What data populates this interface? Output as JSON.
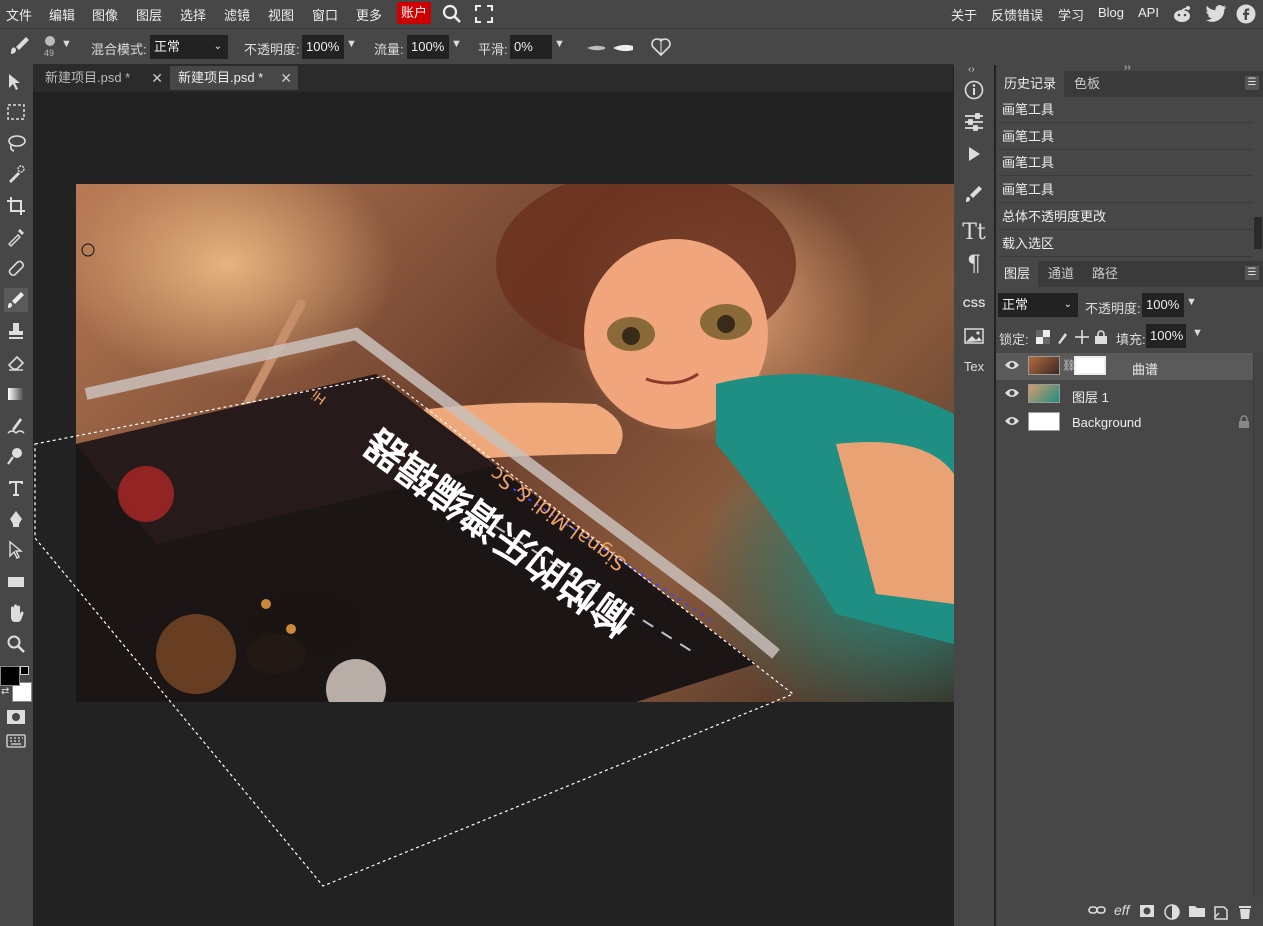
{
  "menu": {
    "items": [
      "文件",
      "编辑",
      "图像",
      "图层",
      "选择",
      "滤镜",
      "视图",
      "窗口",
      "更多"
    ],
    "account": "账户",
    "right_links": [
      "关于",
      "反馈错误",
      "学习",
      "Blog",
      "API"
    ]
  },
  "options": {
    "brush_size": "49",
    "blend_label": "混合模式:",
    "blend_value": "正常",
    "opacity_label": "不透明度:",
    "opacity_value": "100%",
    "flow_label": "流量:",
    "flow_value": "100%",
    "smooth_label": "平滑:",
    "smooth_value": "0%"
  },
  "tabs": [
    {
      "label": "新建项目.psd *",
      "active": false
    },
    {
      "label": "新建项目.psd *",
      "active": true
    }
  ],
  "canvas": {
    "poster_title": "愉悦的乐谱编辑器",
    "poster_subtitle": "Signal-Midi & Sc",
    "poster_hi": "Hi"
  },
  "side_icons": {
    "css": "CSS",
    "tex": "Tex"
  },
  "history": {
    "tabs": [
      "历史记录",
      "色板"
    ],
    "items": [
      "画笔工具",
      "画笔工具",
      "画笔工具",
      "画笔工具",
      "总体不透明度更改",
      "载入选区"
    ]
  },
  "layers": {
    "tabs": [
      "图层",
      "通道",
      "路径"
    ],
    "blend_value": "正常",
    "opacity_label": "不透明度:",
    "opacity_value": "100%",
    "lock_label": "锁定:",
    "fill_label": "填充:",
    "fill_value": "100%",
    "items": [
      {
        "name": "曲谱",
        "selected": true,
        "has_mask": true,
        "locked": false
      },
      {
        "name": "图层 1",
        "selected": false,
        "has_mask": false,
        "locked": false
      },
      {
        "name": "Background",
        "selected": false,
        "has_mask": false,
        "locked": true
      }
    ],
    "footer_icons": [
      "link-icon",
      "effects-icon",
      "mask-icon",
      "adjustment-icon",
      "folder-icon",
      "new-layer-icon",
      "trash-icon"
    ],
    "footer_effects": "eff"
  },
  "colors": {
    "menu_bg": "#474747",
    "workspace_bg": "#222222",
    "account_red": "#cc0000",
    "accent_teal": "#1f8f84"
  }
}
